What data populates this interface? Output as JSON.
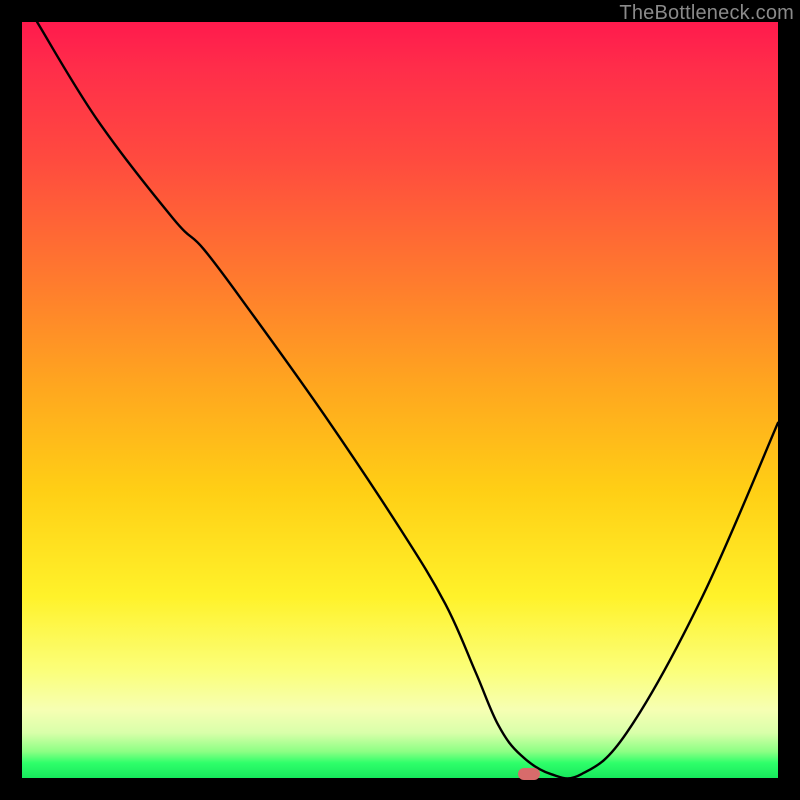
{
  "watermark": "TheBottleneck.com",
  "chart_data": {
    "type": "line",
    "title": "",
    "xlabel": "",
    "ylabel": "",
    "xlim": [
      0,
      100
    ],
    "ylim": [
      0,
      100
    ],
    "series": [
      {
        "name": "bottleneck-curve",
        "x": [
          2,
          10,
          20,
          24,
          30,
          40,
          50,
          56,
          60,
          63,
          66,
          70,
          74,
          80,
          90,
          100
        ],
        "y": [
          100,
          87,
          74,
          70,
          62,
          48,
          33,
          23,
          14,
          7,
          3,
          0.5,
          0.5,
          6,
          24,
          47
        ]
      }
    ],
    "marker": {
      "x": 67,
      "y": 0.5
    },
    "gradient_stops": [
      {
        "pos": 0,
        "color": "#ff1a4d"
      },
      {
        "pos": 0.5,
        "color": "#ffb91a"
      },
      {
        "pos": 0.8,
        "color": "#fff22a"
      },
      {
        "pos": 0.95,
        "color": "#c8ff9e"
      },
      {
        "pos": 1.0,
        "color": "#16e85c"
      }
    ]
  }
}
